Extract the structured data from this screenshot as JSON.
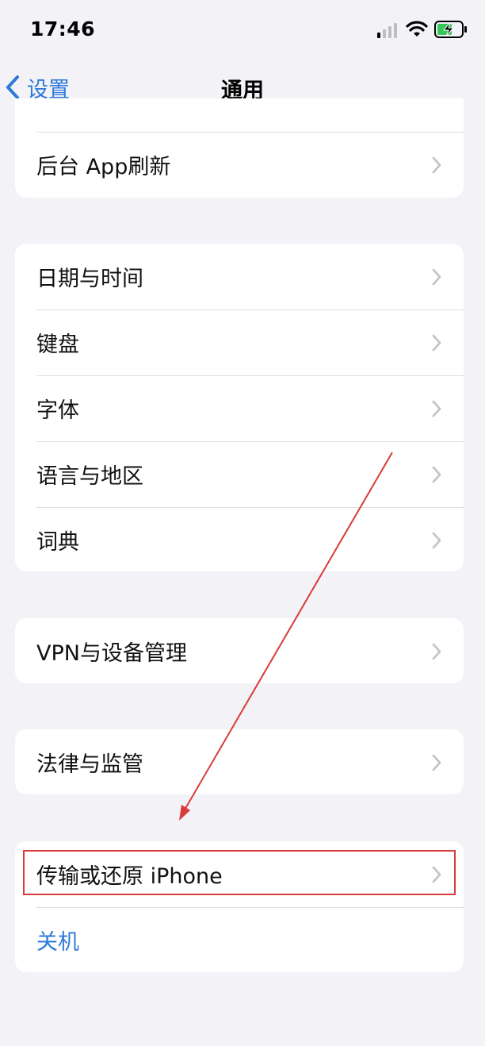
{
  "status_bar": {
    "time": "17:46"
  },
  "nav": {
    "back_label": "设置",
    "title": "通用"
  },
  "groups": [
    {
      "items": [
        {
          "label": "后台 App刷新"
        }
      ]
    },
    {
      "items": [
        {
          "label": "日期与时间"
        },
        {
          "label": "键盘"
        },
        {
          "label": "字体"
        },
        {
          "label": "语言与地区"
        },
        {
          "label": "词典"
        }
      ]
    },
    {
      "items": [
        {
          "label": "VPN与设备管理"
        }
      ]
    },
    {
      "items": [
        {
          "label": "法律与监管"
        }
      ]
    },
    {
      "items": [
        {
          "label": "传输或还原 iPhone"
        },
        {
          "label": "关机"
        }
      ]
    }
  ],
  "colors": {
    "accent": "#2f7ad8",
    "background": "#f2f2f7",
    "annotation": "#d93a3a",
    "battery_charging": "#34c759"
  },
  "icons": [
    "cellular-signal-icon",
    "wifi-icon",
    "battery-charging-icon",
    "chevron-left-icon",
    "chevron-right-icon"
  ]
}
